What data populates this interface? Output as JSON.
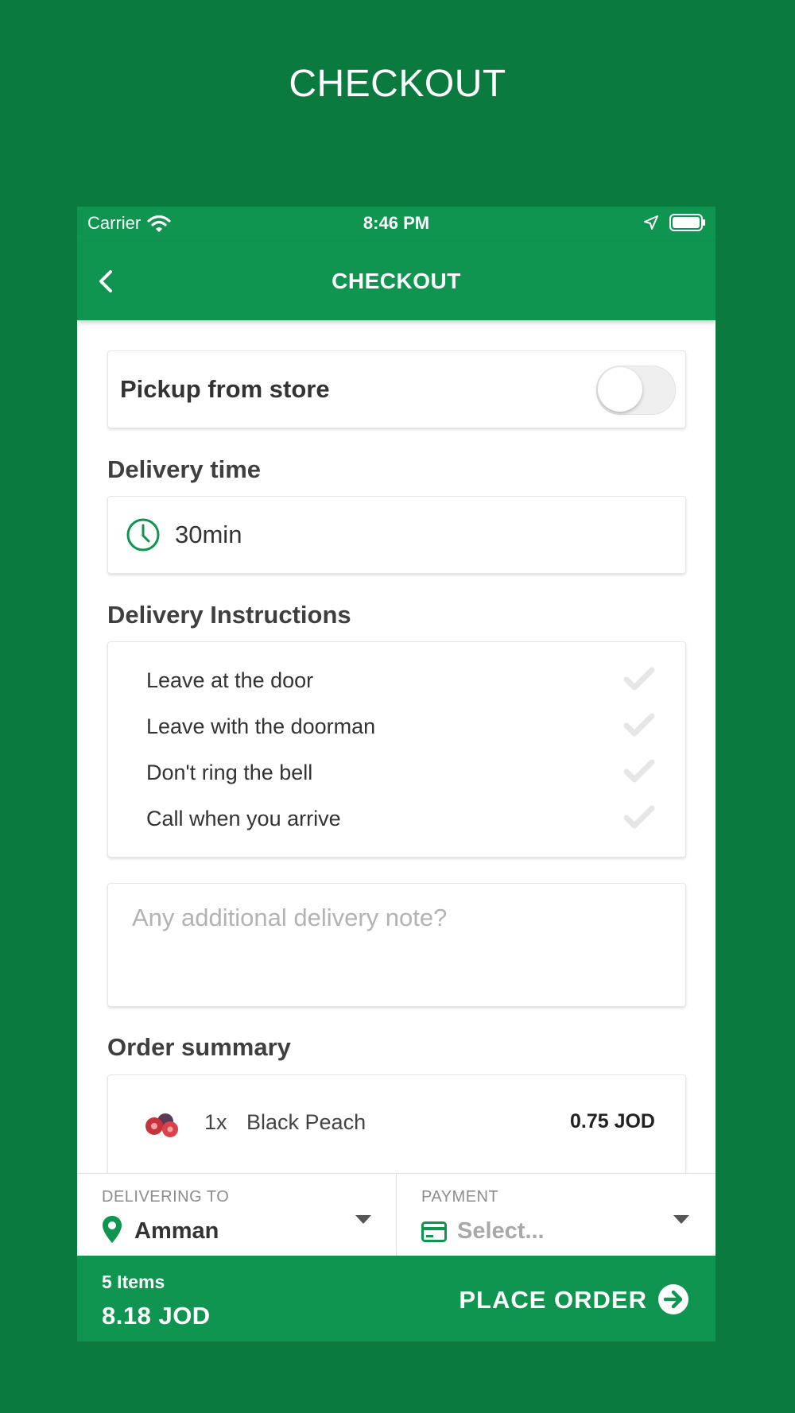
{
  "page_title": "CHECKOUT",
  "status_bar": {
    "carrier": "Carrier",
    "time": "8:46 PM"
  },
  "nav": {
    "title": "CHECKOUT"
  },
  "pickup": {
    "label": "Pickup from store",
    "enabled": false
  },
  "delivery_time": {
    "section_label": "Delivery time",
    "value": "30min"
  },
  "delivery_instructions": {
    "section_label": "Delivery Instructions",
    "options": [
      {
        "label": "Leave at the door",
        "checked": false
      },
      {
        "label": "Leave with the doorman",
        "checked": false
      },
      {
        "label": "Don't ring the bell",
        "checked": false
      },
      {
        "label": "Call when you arrive",
        "checked": false
      }
    ]
  },
  "note": {
    "placeholder": "Any additional delivery note?",
    "value": ""
  },
  "order_summary": {
    "section_label": "Order summary",
    "items": [
      {
        "qty": "1x",
        "name": "Black Peach",
        "price": "0.75 JOD"
      }
    ]
  },
  "delivering_to": {
    "caption": "DELIVERING TO",
    "value": "Amman"
  },
  "payment": {
    "caption": "PAYMENT",
    "value": "Select..."
  },
  "footer": {
    "items_count": "5 Items",
    "total": "8.18 JOD",
    "place_order": "PLACE ORDER"
  },
  "colors": {
    "brand_green": "#0f9550",
    "background_green": "#0b7a3e",
    "check_inactive": "#e6e6e6"
  }
}
